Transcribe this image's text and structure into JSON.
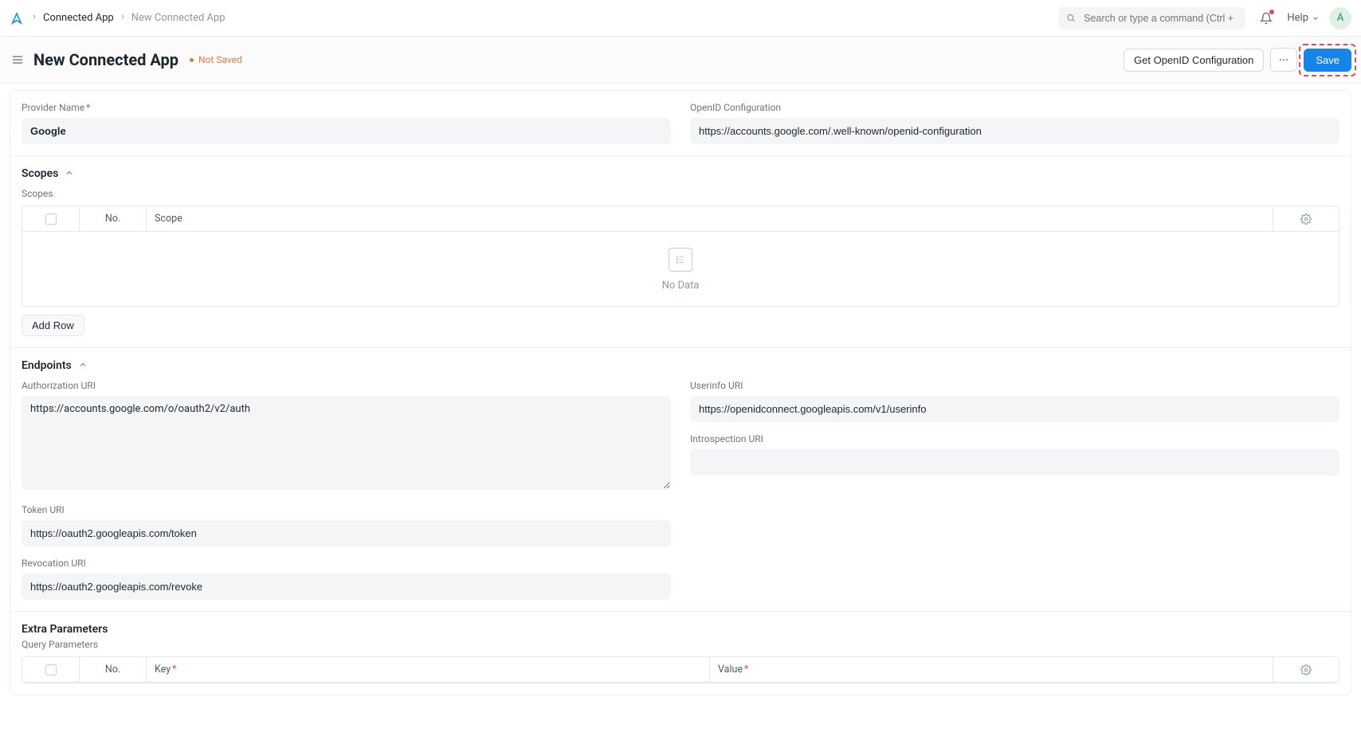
{
  "breadcrumb": {
    "parent": "Connected App",
    "current": "New Connected App"
  },
  "search": {
    "placeholder": "Search or type a command (Ctrl + G)"
  },
  "help": {
    "label": "Help"
  },
  "avatar": {
    "initial": "A"
  },
  "header": {
    "title": "New Connected App",
    "not_saved": "Not Saved",
    "get_openid_btn": "Get OpenID Configuration",
    "save_btn": "Save"
  },
  "form": {
    "provider_name_label": "Provider Name",
    "provider_name_value": "Google",
    "openid_conf_label": "OpenID Configuration",
    "openid_conf_value": "https://accounts.google.com/.well-known/openid-configuration"
  },
  "scopes": {
    "section_title": "Scopes",
    "table_label": "Scopes",
    "cols": {
      "no": "No.",
      "scope": "Scope"
    },
    "no_data": "No Data",
    "add_row": "Add Row"
  },
  "endpoints": {
    "section_title": "Endpoints",
    "authorization_uri_label": "Authorization URI",
    "authorization_uri_value": "https://accounts.google.com/o/oauth2/v2/auth",
    "token_uri_label": "Token URI",
    "token_uri_value": "https://oauth2.googleapis.com/token",
    "revocation_uri_label": "Revocation URI",
    "revocation_uri_value": "https://oauth2.googleapis.com/revoke",
    "userinfo_uri_label": "Userinfo URI",
    "userinfo_uri_value": "https://openidconnect.googleapis.com/v1/userinfo",
    "introspection_uri_label": "Introspection URI",
    "introspection_uri_value": ""
  },
  "extra_params": {
    "section_title": "Extra Parameters",
    "table_label": "Query Parameters",
    "cols": {
      "no": "No.",
      "key": "Key",
      "value": "Value"
    }
  }
}
